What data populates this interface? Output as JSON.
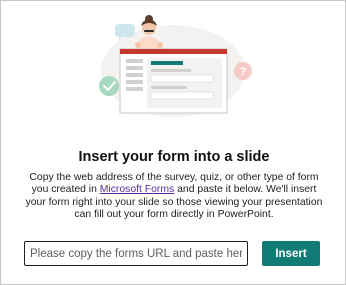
{
  "dialog": {
    "title": "Insert your form into a slide",
    "description": {
      "part1": "Copy the web address of the survey, quiz, or other type of form you created in ",
      "link_text": "Microsoft Forms",
      "part2": " and paste it below. We'll insert your form right into your slide so those viewing your presentation can fill out your form directly in PowerPoint."
    },
    "url_input": {
      "placeholder": "Please copy the forms URL and paste here",
      "value": ""
    },
    "insert_label": "Insert"
  },
  "colors": {
    "accent": "#107c75",
    "link": "#5b2ca0",
    "slide_header": "#c4392f",
    "check_badge": "#a8d8bf",
    "question_badge": "#f6cbc6",
    "chat_bubble": "#cfe6ed"
  },
  "icons": {
    "illustration": "person-presenting-form-illustration",
    "check": "checkmark-icon",
    "question": "question-mark-icon",
    "chat": "chat-bubble-icon"
  }
}
